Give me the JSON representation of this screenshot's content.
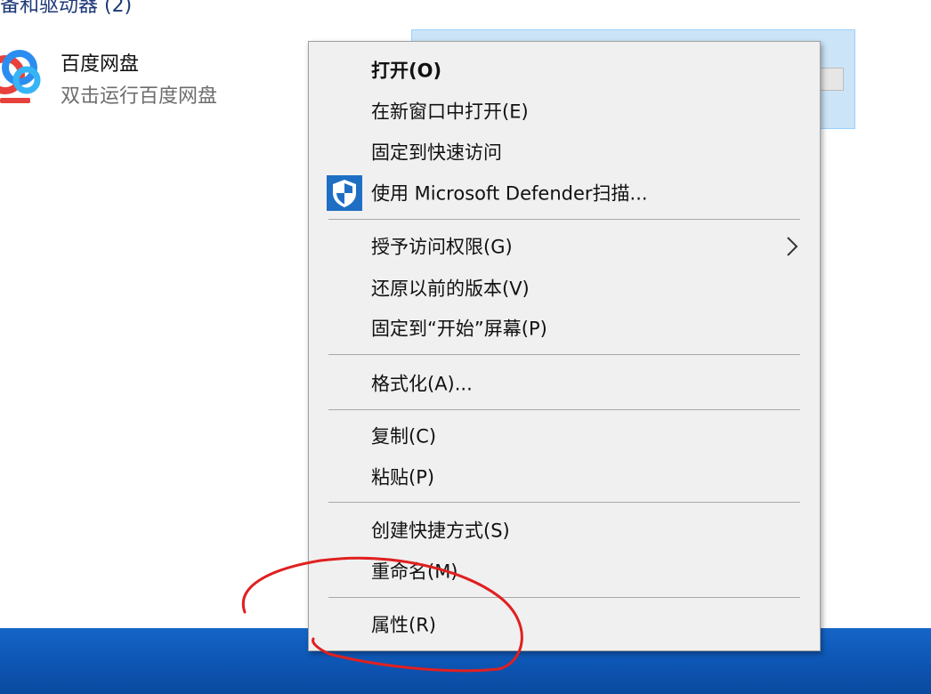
{
  "explorer": {
    "section_header": "备和驱动器 (2)",
    "app": {
      "name": "百度网盘",
      "description": "双击运行百度网盘"
    }
  },
  "context_menu": {
    "items": [
      {
        "label": "打开(O)",
        "bold": true
      },
      {
        "label": "在新窗口中打开(E)"
      },
      {
        "label": "固定到快速访问"
      },
      {
        "label": "使用 Microsoft Defender扫描...",
        "icon": "defender-shield-icon"
      },
      {
        "label": "授予访问权限(G)",
        "submenu": true
      },
      {
        "label": "还原以前的版本(V)"
      },
      {
        "label": "固定到“开始”屏幕(P)"
      },
      {
        "label": "格式化(A)..."
      },
      {
        "label": "复制(C)"
      },
      {
        "label": "粘贴(P)"
      },
      {
        "label": "创建快捷方式(S)"
      },
      {
        "label": "重命名(M)"
      },
      {
        "label": "属性(R)"
      }
    ]
  },
  "colors": {
    "menu_background": "#f0f0f0",
    "selection": "#cce4f7",
    "taskbar": "#0d55b3",
    "annotation": "#e02020",
    "defender_blue": "#1e6fc4"
  }
}
